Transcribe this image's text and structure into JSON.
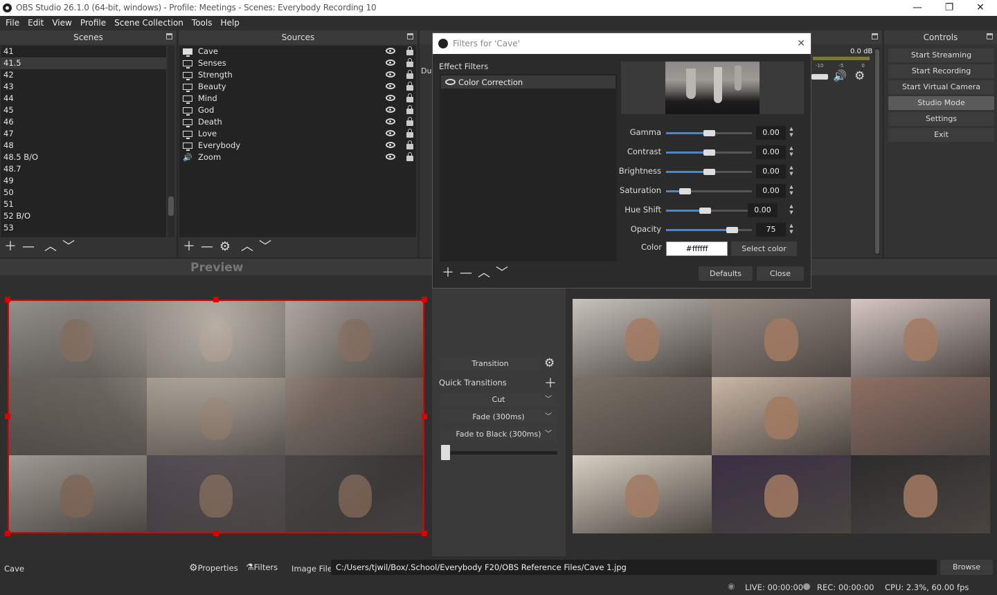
{
  "window": {
    "title": "OBS Studio 26.1.0 (64-bit, windows) - Profile: Meetings - Scenes: Everybody Recording  10"
  },
  "menu": [
    "File",
    "Edit",
    "View",
    "Profile",
    "Scene Collection",
    "Tools",
    "Help"
  ],
  "scenes": {
    "title": "Scenes",
    "items": [
      "41",
      "41.5",
      "42",
      "43",
      "44",
      "45",
      "46",
      "47",
      "48",
      "48.5 B/O",
      "48.7",
      "49",
      "50",
      "51",
      "52 B/O",
      "53"
    ],
    "selected_index": 1
  },
  "sources": {
    "title": "Sources",
    "items": [
      {
        "name": "Cave",
        "type": "image"
      },
      {
        "name": "Senses",
        "type": "display"
      },
      {
        "name": "Strength",
        "type": "display"
      },
      {
        "name": "Beauty",
        "type": "display"
      },
      {
        "name": "Mind",
        "type": "display"
      },
      {
        "name": "God",
        "type": "display"
      },
      {
        "name": "Death",
        "type": "display"
      },
      {
        "name": "Love",
        "type": "display"
      },
      {
        "name": "Everybody",
        "type": "display"
      },
      {
        "name": "Zoom",
        "type": "audio"
      }
    ]
  },
  "controls": {
    "title": "Controls",
    "buttons": [
      "Start Streaming",
      "Start Recording",
      "Start Virtual Camera",
      "Studio Mode",
      "Settings",
      "Exit"
    ],
    "active_index": 3
  },
  "mixer": {
    "db": "0.0 dB",
    "ticks": [
      "-10",
      "-5",
      "0"
    ]
  },
  "preview": {
    "label": "Preview"
  },
  "transitions": {
    "transition_button": "Transition",
    "quick_label": "Quick Transitions",
    "options": [
      "Cut",
      "Fade (300ms)",
      "Fade to Black (300ms)"
    ],
    "tbar_value": 0
  },
  "filters_dialog": {
    "title": "Filters for 'Cave'",
    "section": "Effect Filters",
    "filter_items": [
      "Color Correction"
    ],
    "params": [
      {
        "label": "Gamma",
        "value": "0.00",
        "level": 0.5
      },
      {
        "label": "Contrast",
        "value": "0.00",
        "level": 0.5
      },
      {
        "label": "Brightness",
        "value": "0.00",
        "level": 0.5
      },
      {
        "label": "Saturation",
        "value": "0.00",
        "level": 0.22
      },
      {
        "label": "Hue Shift",
        "value": "0.00",
        "level": 0.45
      },
      {
        "label": "Opacity",
        "value": "75",
        "level": 0.77
      }
    ],
    "color_label": "Color",
    "color_value": "#ffffff",
    "select_color": "Select color",
    "defaults": "Defaults",
    "close": "Close"
  },
  "bottom": {
    "source_name": "Cave",
    "properties": "Properties",
    "filters": "Filters",
    "image_file_label": "Image File",
    "path": "C:/Users/tjwil/Box/.School/Everybody F20/OBS Reference Files/Cave 1.jpg",
    "browse": "Browse"
  },
  "status": {
    "live": "LIVE: 00:00:00",
    "rec": "REC: 00:00:00",
    "cpu": "CPU: 2.3%, 60.00 fps"
  },
  "colors": {
    "accent": "#3d8be0",
    "selection": "#e00000",
    "panel": "#333333",
    "list_bg": "#232323"
  }
}
